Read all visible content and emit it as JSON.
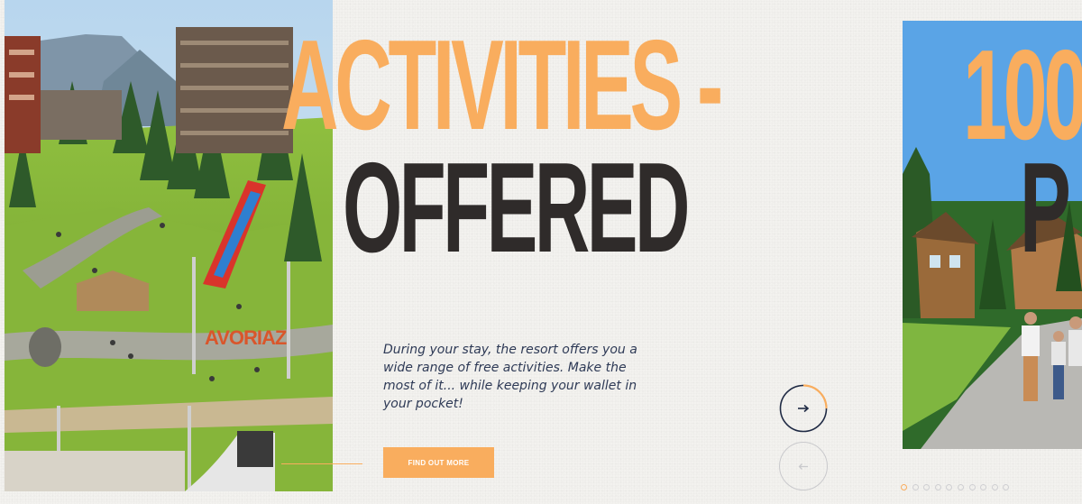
{
  "slide": {
    "title_line1": "ACTIVITIES -",
    "title_line2": "OFFERED",
    "description": "During your stay, the resort offers you a wide range of free activities. Make the most of it... while keeping your wallet in your pocket!",
    "cta_label": "FIND OUT MORE",
    "photo_sign_text": "AVORIAZ"
  },
  "next_slide": {
    "title_line1": "100",
    "title_line2": "P"
  },
  "carousel": {
    "next_icon": "arrow-right-icon",
    "prev_icon": "arrow-left-icon",
    "progress": 0.25,
    "dots_count": 10,
    "active_dot": 0
  },
  "colors": {
    "accent": "#f9ad5e",
    "dark_text": "#2f2b2a",
    "body_text": "#2e3a56",
    "background": "#f3f2ef"
  }
}
